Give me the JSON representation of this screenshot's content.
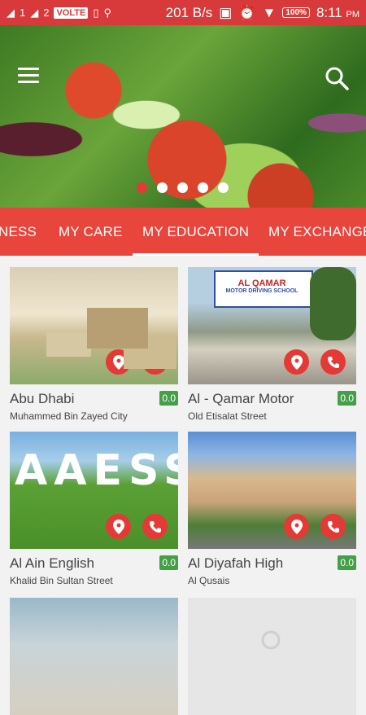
{
  "status_bar": {
    "sim1": "1",
    "sim2": "2",
    "volte": "VOLTE",
    "speed": "201 B/s",
    "battery": "100%",
    "time": "8:11",
    "ampm": "PM"
  },
  "hero": {
    "slide_count": 5,
    "active_slide": 0
  },
  "tabs": [
    {
      "label": "NESS",
      "active": false
    },
    {
      "label": "MY CARE",
      "active": false
    },
    {
      "label": "MY EDUCATION",
      "active": true
    },
    {
      "label": "MY EXCHANGE",
      "active": false
    }
  ],
  "cards": [
    {
      "title": "Abu Dhabi",
      "subtitle": "Muhammed Bin Zayed City",
      "rating": "0.0",
      "image": "abu-dhabi-campus"
    },
    {
      "title": "Al - Qamar Motor",
      "subtitle": "Old Etisalat Street",
      "rating": "0.0",
      "image": "al-qamar-driving-school"
    },
    {
      "title": "Al Ain English",
      "subtitle": "Khalid Bin Sultan Street",
      "rating": "0.0",
      "image": "aaess-sign"
    },
    {
      "title": "Al Diyafah High",
      "subtitle": "Al Qusais",
      "rating": "0.0",
      "image": "al-diyafah-school"
    }
  ],
  "signs": {
    "qamar_top": "AL QAMAR",
    "qamar_sub": "MOTOR DRIVING SCHOOL",
    "aaess": "AAESS"
  },
  "colors": {
    "status_bar": "#d8393a",
    "tab_bar": "#e8453c",
    "action_button": "#e53935",
    "rating_badge": "#43a047"
  }
}
